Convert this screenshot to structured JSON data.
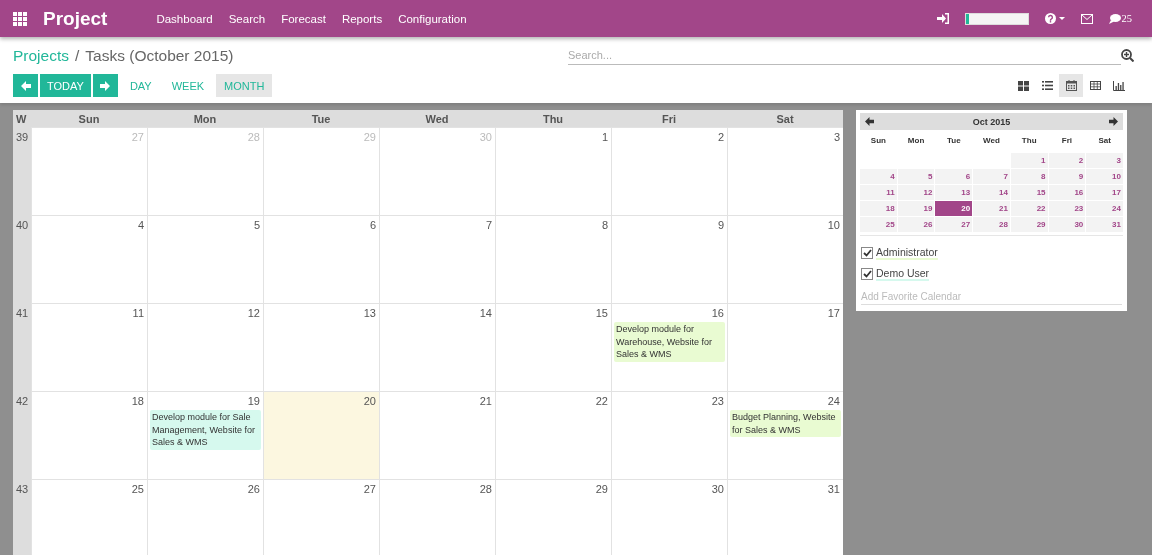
{
  "app": {
    "title": "Project"
  },
  "menu": [
    {
      "label": "Dashboard"
    },
    {
      "label": "Search"
    },
    {
      "label": "Forecast"
    },
    {
      "label": "Reports"
    },
    {
      "label": "Configuration"
    }
  ],
  "systray": {
    "progress": {
      "level": 0.06
    },
    "messages": "25"
  },
  "breadcrumb": {
    "separator": "/",
    "items": [
      {
        "label": "Projects"
      },
      {
        "label": "Tasks (October 2015)"
      }
    ]
  },
  "search": {
    "placeholder": "Search..."
  },
  "nav_buttons": [
    {
      "kind": "prev"
    },
    {
      "kind": "today",
      "label": "TODAY"
    },
    {
      "kind": "next"
    }
  ],
  "scales": [
    {
      "label": "DAY",
      "selected": false
    },
    {
      "label": "WEEK",
      "selected": false
    },
    {
      "label": "MONTH",
      "selected": true
    }
  ],
  "views": [
    {
      "kind": "kanban",
      "selected": false
    },
    {
      "kind": "list",
      "selected": false
    },
    {
      "kind": "calendar",
      "selected": true
    },
    {
      "kind": "pivot",
      "selected": false
    },
    {
      "kind": "graph",
      "selected": false
    }
  ],
  "calendar": {
    "week_heading": "W",
    "day_headings": [
      "Sun",
      "Mon",
      "Tue",
      "Wed",
      "Thu",
      "Fri",
      "Sat"
    ],
    "weeks": [
      {
        "number": "39",
        "days": [
          {
            "date": "27",
            "other_month": true,
            "today": false
          },
          {
            "date": "28",
            "other_month": true,
            "today": false
          },
          {
            "date": "29",
            "other_month": true,
            "today": false
          },
          {
            "date": "30",
            "other_month": true,
            "today": false
          },
          {
            "date": "1",
            "other_month": false,
            "today": false
          },
          {
            "date": "2",
            "other_month": false,
            "today": false
          },
          {
            "date": "3",
            "other_month": false,
            "today": false
          }
        ]
      },
      {
        "number": "40",
        "days": [
          {
            "date": "4",
            "other_month": false,
            "today": false
          },
          {
            "date": "5",
            "other_month": false,
            "today": false
          },
          {
            "date": "6",
            "other_month": false,
            "today": false
          },
          {
            "date": "7",
            "other_month": false,
            "today": false
          },
          {
            "date": "8",
            "other_month": false,
            "today": false
          },
          {
            "date": "9",
            "other_month": false,
            "today": false
          },
          {
            "date": "10",
            "other_month": false,
            "today": false
          }
        ]
      },
      {
        "number": "41",
        "days": [
          {
            "date": "11",
            "other_month": false,
            "today": false
          },
          {
            "date": "12",
            "other_month": false,
            "today": false
          },
          {
            "date": "13",
            "other_month": false,
            "today": false
          },
          {
            "date": "14",
            "other_month": false,
            "today": false
          },
          {
            "date": "15",
            "other_month": false,
            "today": false
          },
          {
            "date": "16",
            "other_month": false,
            "today": false,
            "events": [
              {
                "title": "Develop module for Warehouse, Website for Sales & WMS",
                "color": "#e9fbd2"
              }
            ]
          },
          {
            "date": "17",
            "other_month": false,
            "today": false
          }
        ]
      },
      {
        "number": "42",
        "days": [
          {
            "date": "18",
            "other_month": false,
            "today": false
          },
          {
            "date": "19",
            "other_month": false,
            "today": false,
            "events": [
              {
                "title": "Develop module for Sale Management, Website for Sales & WMS",
                "color": "#d6f9ee"
              }
            ]
          },
          {
            "date": "20",
            "other_month": false,
            "today": true
          },
          {
            "date": "21",
            "other_month": false,
            "today": false
          },
          {
            "date": "22",
            "other_month": false,
            "today": false
          },
          {
            "date": "23",
            "other_month": false,
            "today": false
          },
          {
            "date": "24",
            "other_month": false,
            "today": false,
            "events": [
              {
                "title": "Budget Planning, Website for Sales & WMS",
                "color": "#e9fbd2"
              }
            ]
          }
        ]
      },
      {
        "number": "43",
        "days": [
          {
            "date": "25",
            "other_month": false,
            "today": false
          },
          {
            "date": "26",
            "other_month": false,
            "today": false
          },
          {
            "date": "27",
            "other_month": false,
            "today": false
          },
          {
            "date": "28",
            "other_month": false,
            "today": false
          },
          {
            "date": "29",
            "other_month": false,
            "today": false
          },
          {
            "date": "30",
            "other_month": false,
            "today": false
          },
          {
            "date": "31",
            "other_month": false,
            "today": false
          }
        ]
      }
    ]
  },
  "mini_calendar": {
    "title": "Oct 2015",
    "day_headings": [
      "Sun",
      "Mon",
      "Tue",
      "Wed",
      "Thu",
      "Fri",
      "Sat"
    ],
    "weeks": [
      [
        {
          "day": "1",
          "selected": false
        },
        {
          "day": "2",
          "selected": false
        },
        {
          "day": "3",
          "selected": false
        }
      ],
      [
        {
          "day": "4",
          "selected": false
        },
        {
          "day": "5",
          "selected": false
        },
        {
          "day": "6",
          "selected": false
        },
        {
          "day": "7",
          "selected": false
        },
        {
          "day": "8",
          "selected": false
        },
        {
          "day": "9",
          "selected": false
        },
        {
          "day": "10",
          "selected": false
        }
      ],
      [
        {
          "day": "11",
          "selected": false
        },
        {
          "day": "12",
          "selected": false
        },
        {
          "day": "13",
          "selected": false
        },
        {
          "day": "14",
          "selected": false
        },
        {
          "day": "15",
          "selected": false
        },
        {
          "day": "16",
          "selected": false
        },
        {
          "day": "17",
          "selected": false
        }
      ],
      [
        {
          "day": "18",
          "selected": false
        },
        {
          "day": "19",
          "selected": false
        },
        {
          "day": "20",
          "selected": true
        },
        {
          "day": "21",
          "selected": false
        },
        {
          "day": "22",
          "selected": false
        },
        {
          "day": "23",
          "selected": false
        },
        {
          "day": "24",
          "selected": false
        }
      ],
      [
        {
          "day": "25",
          "selected": false
        },
        {
          "day": "26",
          "selected": false
        },
        {
          "day": "27",
          "selected": false
        },
        {
          "day": "28",
          "selected": false
        },
        {
          "day": "29",
          "selected": false
        },
        {
          "day": "30",
          "selected": false
        },
        {
          "day": "31",
          "selected": false
        }
      ]
    ]
  },
  "filters": [
    {
      "label": "Administrator",
      "checked": true,
      "color": "#e9fbd2"
    },
    {
      "label": "Demo User",
      "checked": true,
      "color": "#d6f9ee"
    }
  ],
  "favorite": {
    "placeholder": "Add Favorite Calendar"
  }
}
